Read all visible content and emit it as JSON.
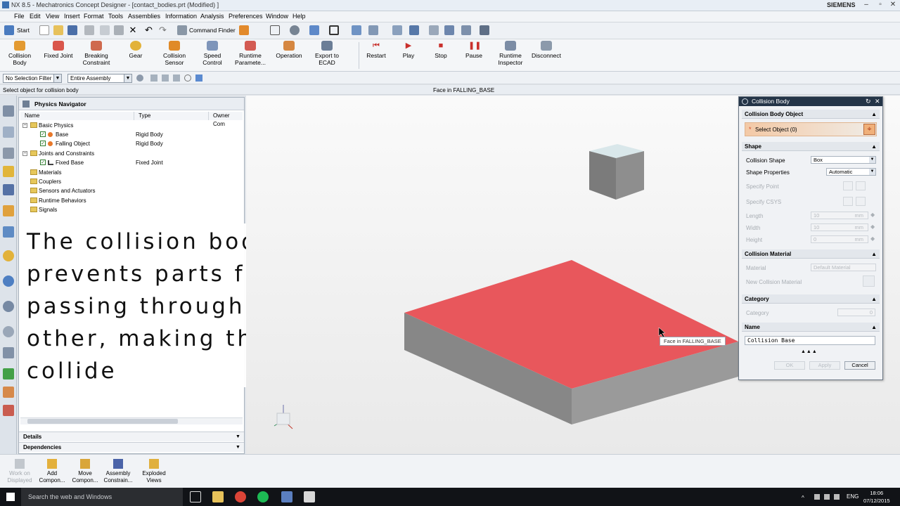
{
  "window": {
    "title": "NX 8.5 - Mechatronics Concept Designer - [contact_bodies.prt (Modified) ]",
    "brand": "SIEMENS"
  },
  "menu": [
    "File",
    "Edit",
    "View",
    "Insert",
    "Format",
    "Tools",
    "Assemblies",
    "Information",
    "Analysis",
    "Preferences",
    "Window",
    "Help"
  ],
  "quickbar": {
    "start": "Start",
    "command_finder": "Command Finder"
  },
  "ribbon": [
    {
      "label": "Collision\nBody",
      "icon": "collision-body-icon"
    },
    {
      "label": "Fixed Joint",
      "icon": "fixed-joint-icon"
    },
    {
      "label": "Breaking\nConstraint",
      "icon": "breaking-constraint-icon"
    },
    {
      "label": "Gear",
      "icon": "gear-icon"
    },
    {
      "label": "Collision\nSensor",
      "icon": "collision-sensor-icon"
    },
    {
      "label": "Speed\nControl",
      "icon": "speed-control-icon"
    },
    {
      "label": "Runtime\nParamete...",
      "icon": "runtime-parameters-icon"
    },
    {
      "label": "Operation",
      "icon": "operation-icon"
    },
    {
      "label": "Export to\nECAD",
      "icon": "export-ecad-icon"
    },
    {
      "label": "Restart",
      "icon": "restart-icon"
    },
    {
      "label": "Play",
      "icon": "play-icon"
    },
    {
      "label": "Stop",
      "icon": "stop-icon"
    },
    {
      "label": "Pause",
      "icon": "pause-icon"
    },
    {
      "label": "Runtime\nInspector",
      "icon": "runtime-inspector-icon"
    },
    {
      "label": "Disconnect",
      "icon": "disconnect-icon"
    }
  ],
  "selection": {
    "filter": "No Selection Filter",
    "scope": "Entire Assembly"
  },
  "status": {
    "prompt": "Select object for collision body",
    "hover": "Face in FALLING_BASE"
  },
  "navigator": {
    "title": "Physics Navigator",
    "columns": [
      "Name",
      "Type",
      "Owner Com"
    ],
    "rows": [
      {
        "name": "Basic Physics",
        "type": "",
        "level": 0,
        "kind": "folder",
        "expanded": true
      },
      {
        "name": "Base",
        "type": "Rigid Body",
        "level": 1,
        "kind": "body"
      },
      {
        "name": "Falling Object",
        "type": "Rigid Body",
        "level": 1,
        "kind": "body"
      },
      {
        "name": "Joints and Constraints",
        "type": "",
        "level": 0,
        "kind": "folder",
        "expanded": true
      },
      {
        "name": "Fixed Base",
        "type": "Fixed Joint",
        "level": 1,
        "kind": "joint"
      },
      {
        "name": "Materials",
        "type": "",
        "level": 0,
        "kind": "folder"
      },
      {
        "name": "Couplers",
        "type": "",
        "level": 0,
        "kind": "folder"
      },
      {
        "name": "Sensors and Actuators",
        "type": "",
        "level": 0,
        "kind": "folder"
      },
      {
        "name": "Runtime Behaviors",
        "type": "",
        "level": 0,
        "kind": "folder"
      },
      {
        "name": "Signals",
        "type": "",
        "level": 0,
        "kind": "folder"
      }
    ],
    "details": "Details",
    "dependencies": "Dependencies"
  },
  "caption": [
    "The collision body tool",
    "prevents parts from",
    "passing through each",
    "other, making them",
    "collide"
  ],
  "viewport": {
    "tooltip": "Face in FALLING_BASE",
    "colors": {
      "highlight": "#e8575c",
      "box": "#8a8a8a"
    }
  },
  "dialog": {
    "title": "Collision Body",
    "sec_object": "Collision Body Object",
    "select_object": "Select Object (0)",
    "sec_shape": "Shape",
    "collision_shape_label": "Collision Shape",
    "collision_shape_value": "Box",
    "shape_props_label": "Shape Properties",
    "shape_props_value": "Automatic",
    "specify_point": "Specify Point",
    "specify_csys": "Specify CSYS",
    "length_label": "Length",
    "length_value": "10",
    "length_unit": "mm",
    "width_label": "Width",
    "width_value": "10",
    "width_unit": "mm",
    "height_label": "Height",
    "height_value": "0",
    "height_unit": "mm",
    "sec_material": "Collision Material",
    "material_label": "Material",
    "material_value": "Default Material",
    "new_material": "New Collision Material",
    "sec_category": "Category",
    "category_label": "Category",
    "category_value": "0",
    "sec_name": "Name",
    "name_value": "Collision Base",
    "ok": "OK",
    "apply": "Apply",
    "cancel": "Cancel"
  },
  "assembly_bar": [
    {
      "label": "Work on\nDisplayed",
      "disabled": true
    },
    {
      "label": "Add\nCompon...",
      "disabled": false
    },
    {
      "label": "Move\nCompon...",
      "disabled": false
    },
    {
      "label": "Assembly\nConstrain...",
      "disabled": false
    },
    {
      "label": "Exploded\nViews",
      "disabled": false
    }
  ],
  "taskbar": {
    "search": "Search the web and Windows",
    "lang": "ENG",
    "time": "18:06",
    "date": "07/12/2015"
  }
}
